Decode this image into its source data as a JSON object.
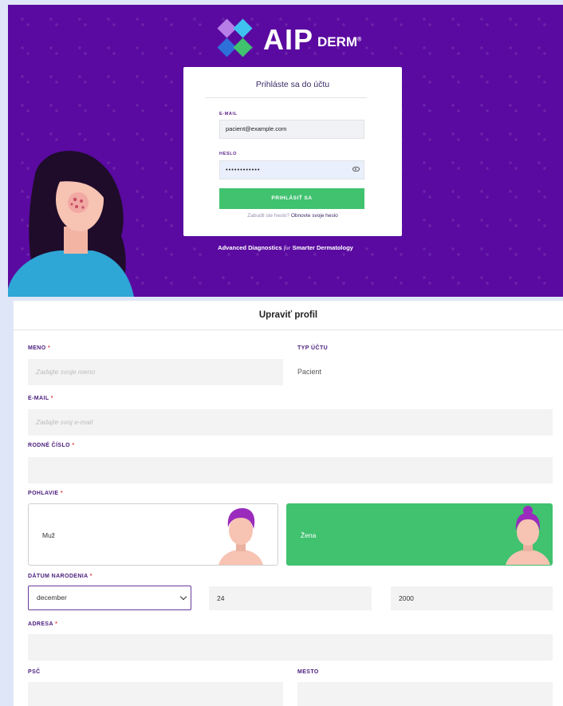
{
  "login": {
    "logo_text": "AIP",
    "logo_sub": "DERM",
    "logo_reg": "®",
    "title": "Prihláste sa do účtu",
    "email_label": "E-MAIL",
    "email_value": "pacient@example.com",
    "password_label": "HESLO",
    "password_value": "••••••••••••",
    "submit_label": "PRIHLÁSIŤ SA",
    "forgot_text": "Zabudli ste heslo?",
    "reset_link": "Obnovte svoje heslo",
    "tagline_a": "Advanced Diagnostics",
    "tagline_for": "for",
    "tagline_b": "Smarter Dermatology"
  },
  "colors": {
    "brand_purple": "#5a0aa0",
    "accent_green": "#40c26f",
    "label_purple": "#4a1c7c",
    "required_red": "#e0424f",
    "logo_diamonds": [
      "#b77ee8",
      "#3fc2f0",
      "#2e6fd9",
      "#40c26f"
    ]
  },
  "profile": {
    "header": "Upraviť profil",
    "required_mark": "*",
    "name": {
      "label": "MENO",
      "placeholder": "Zadajte svoje meno"
    },
    "account_type": {
      "label": "TYP ÚČTU",
      "value": "Pacient"
    },
    "email": {
      "label": "E-MAIL",
      "placeholder": "Zadajte svoj e-mail"
    },
    "birth_number": {
      "label": "RODNÉ ČÍSLO",
      "value": ""
    },
    "gender": {
      "label": "POHLAVIE",
      "options": [
        "Muž",
        "Žena"
      ],
      "selected": "Žena"
    },
    "birth_date": {
      "label": "DÁTUM NARODENIA",
      "month": "december",
      "day": "24",
      "year": "2000"
    },
    "address": {
      "label": "ADRESA",
      "value": ""
    },
    "postal_code": {
      "label": "PSČ",
      "value": ""
    },
    "city": {
      "label": "MESTO",
      "value": ""
    }
  }
}
